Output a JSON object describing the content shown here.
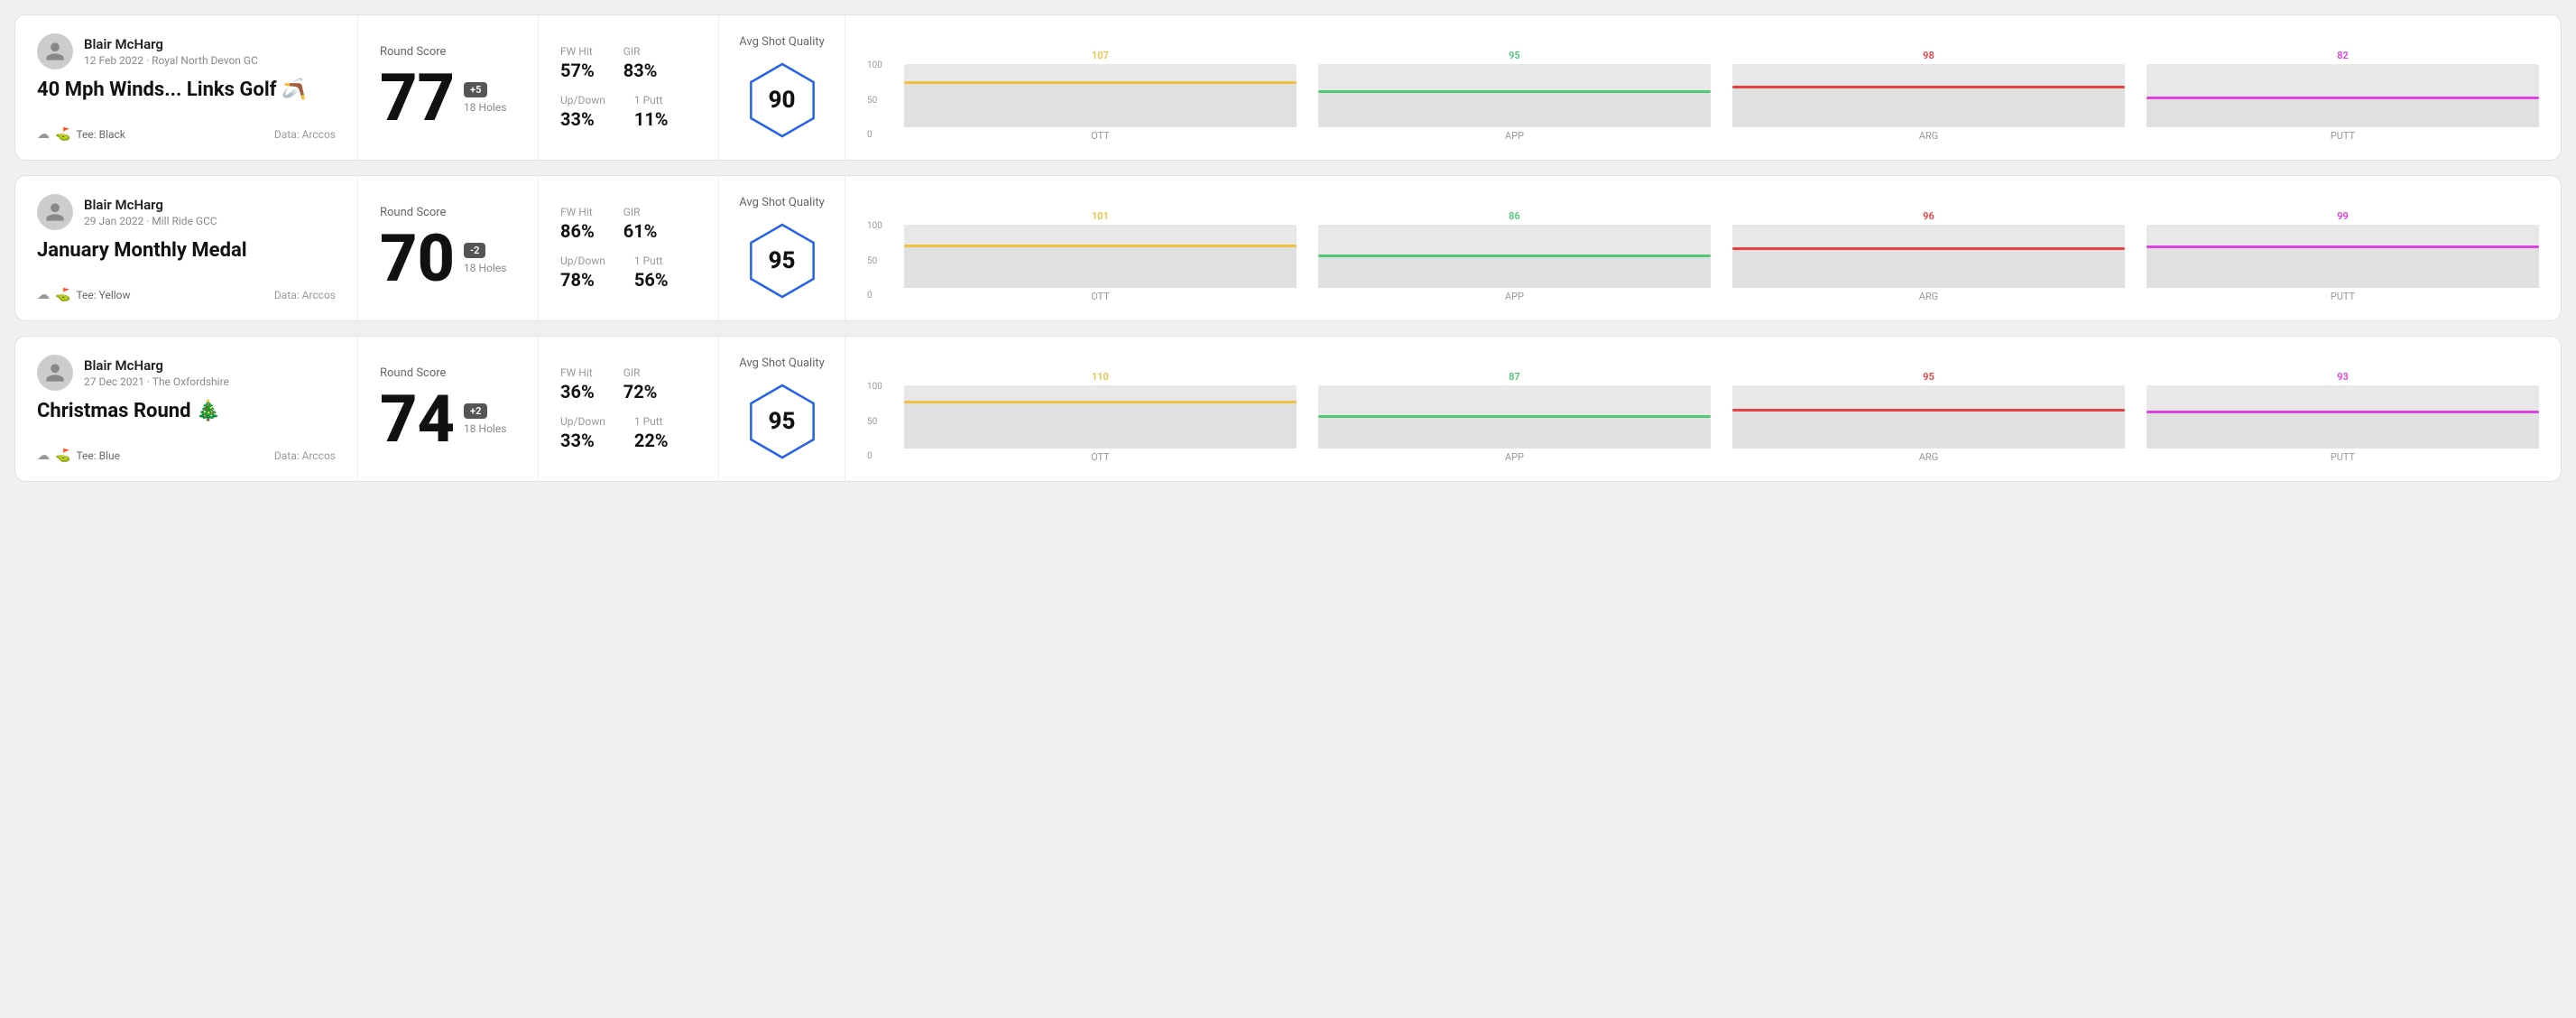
{
  "rounds": [
    {
      "id": "round1",
      "user": {
        "name": "Blair McHarg",
        "date": "12 Feb 2022",
        "course": "Royal North Devon GC"
      },
      "title": "40 Mph Winds... Links Golf 🪃",
      "tee": "Black",
      "data_source": "Data: Arccos",
      "score": 77,
      "score_diff": "+5",
      "holes": "18 Holes",
      "fw_hit": "57%",
      "gir": "83%",
      "up_down": "33%",
      "one_putt": "11%",
      "avg_shot_quality": 90,
      "chart": {
        "ott": {
          "val": 107,
          "color": "#f0c040",
          "bar_pct": 68
        },
        "app": {
          "val": 95,
          "color": "#50c878",
          "bar_pct": 55
        },
        "arg": {
          "val": 98,
          "color": "#e84040",
          "bar_pct": 62
        },
        "putt": {
          "val": 82,
          "color": "#e040e0",
          "bar_pct": 45
        }
      }
    },
    {
      "id": "round2",
      "user": {
        "name": "Blair McHarg",
        "date": "29 Jan 2022",
        "course": "Mill Ride GCC"
      },
      "title": "January Monthly Medal",
      "tee": "Yellow",
      "data_source": "Data: Arccos",
      "score": 70,
      "score_diff": "-2",
      "holes": "18 Holes",
      "fw_hit": "86%",
      "gir": "61%",
      "up_down": "78%",
      "one_putt": "56%",
      "avg_shot_quality": 95,
      "chart": {
        "ott": {
          "val": 101,
          "color": "#f0c040",
          "bar_pct": 65
        },
        "app": {
          "val": 86,
          "color": "#50c878",
          "bar_pct": 48
        },
        "arg": {
          "val": 96,
          "color": "#e84040",
          "bar_pct": 60
        },
        "putt": {
          "val": 99,
          "color": "#e040e0",
          "bar_pct": 63
        }
      }
    },
    {
      "id": "round3",
      "user": {
        "name": "Blair McHarg",
        "date": "27 Dec 2021",
        "course": "The Oxfordshire"
      },
      "title": "Christmas Round 🎄",
      "tee": "Blue",
      "data_source": "Data: Arccos",
      "score": 74,
      "score_diff": "+2",
      "holes": "18 Holes",
      "fw_hit": "36%",
      "gir": "72%",
      "up_down": "33%",
      "one_putt": "22%",
      "avg_shot_quality": 95,
      "chart": {
        "ott": {
          "val": 110,
          "color": "#f0c040",
          "bar_pct": 72
        },
        "app": {
          "val": 87,
          "color": "#50c878",
          "bar_pct": 49
        },
        "arg": {
          "val": 95,
          "color": "#e84040",
          "bar_pct": 58
        },
        "putt": {
          "val": 93,
          "color": "#e040e0",
          "bar_pct": 56
        }
      }
    }
  ],
  "labels": {
    "round_score": "Round Score",
    "fw_hit": "FW Hit",
    "gir": "GIR",
    "up_down": "Up/Down",
    "one_putt": "1 Putt",
    "avg_shot_quality": "Avg Shot Quality",
    "tee_prefix": "Tee:",
    "ott": "OTT",
    "app": "APP",
    "arg": "ARG",
    "putt": "PUTT",
    "y100": "100",
    "y50": "50",
    "y0": "0"
  }
}
